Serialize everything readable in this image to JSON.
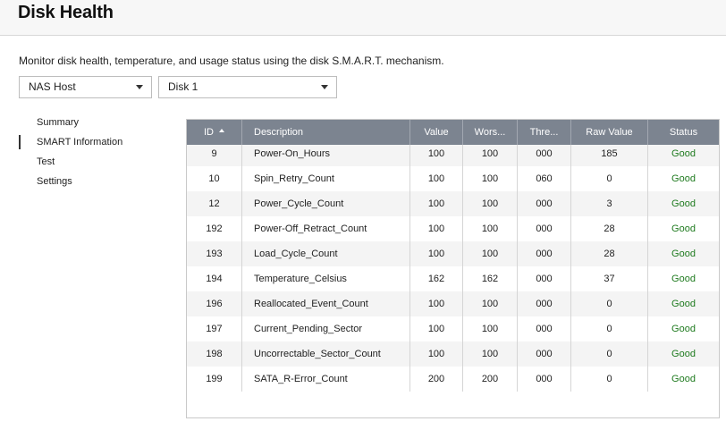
{
  "header": {
    "title": "Disk Health"
  },
  "description": "Monitor disk health, temperature, and usage status using the disk S.M.A.R.T. mechanism.",
  "selectors": {
    "host": "NAS Host",
    "disk": "Disk 1"
  },
  "nav": {
    "items": [
      {
        "label": "Summary",
        "active": false
      },
      {
        "label": "SMART Information",
        "active": true
      },
      {
        "label": "Test",
        "active": false
      },
      {
        "label": "Settings",
        "active": false
      }
    ]
  },
  "table": {
    "columns": [
      "ID",
      "Description",
      "Value",
      "Wors...",
      "Thre...",
      "Raw Value",
      "Status"
    ],
    "sort": {
      "column": "ID",
      "direction": "ascending"
    },
    "rows": [
      {
        "id": "9",
        "description": "Power-On_Hours",
        "value": "100",
        "worst": "100",
        "threshold": "000",
        "raw": "185",
        "status": "Good"
      },
      {
        "id": "10",
        "description": "Spin_Retry_Count",
        "value": "100",
        "worst": "100",
        "threshold": "060",
        "raw": "0",
        "status": "Good"
      },
      {
        "id": "12",
        "description": "Power_Cycle_Count",
        "value": "100",
        "worst": "100",
        "threshold": "000",
        "raw": "3",
        "status": "Good"
      },
      {
        "id": "192",
        "description": "Power-Off_Retract_Count",
        "value": "100",
        "worst": "100",
        "threshold": "000",
        "raw": "28",
        "status": "Good"
      },
      {
        "id": "193",
        "description": "Load_Cycle_Count",
        "value": "100",
        "worst": "100",
        "threshold": "000",
        "raw": "28",
        "status": "Good"
      },
      {
        "id": "194",
        "description": "Temperature_Celsius",
        "value": "162",
        "worst": "162",
        "threshold": "000",
        "raw": "37",
        "status": "Good"
      },
      {
        "id": "196",
        "description": "Reallocated_Event_Count",
        "value": "100",
        "worst": "100",
        "threshold": "000",
        "raw": "0",
        "status": "Good"
      },
      {
        "id": "197",
        "description": "Current_Pending_Sector",
        "value": "100",
        "worst": "100",
        "threshold": "000",
        "raw": "0",
        "status": "Good"
      },
      {
        "id": "198",
        "description": "Uncorrectable_Sector_Count",
        "value": "100",
        "worst": "100",
        "threshold": "000",
        "raw": "0",
        "status": "Good"
      },
      {
        "id": "199",
        "description": "SATA_R-Error_Count",
        "value": "200",
        "worst": "200",
        "threshold": "000",
        "raw": "0",
        "status": "Good"
      }
    ]
  },
  "colors": {
    "header_bg": "#7c8490",
    "status_good": "#1e7a1e"
  }
}
